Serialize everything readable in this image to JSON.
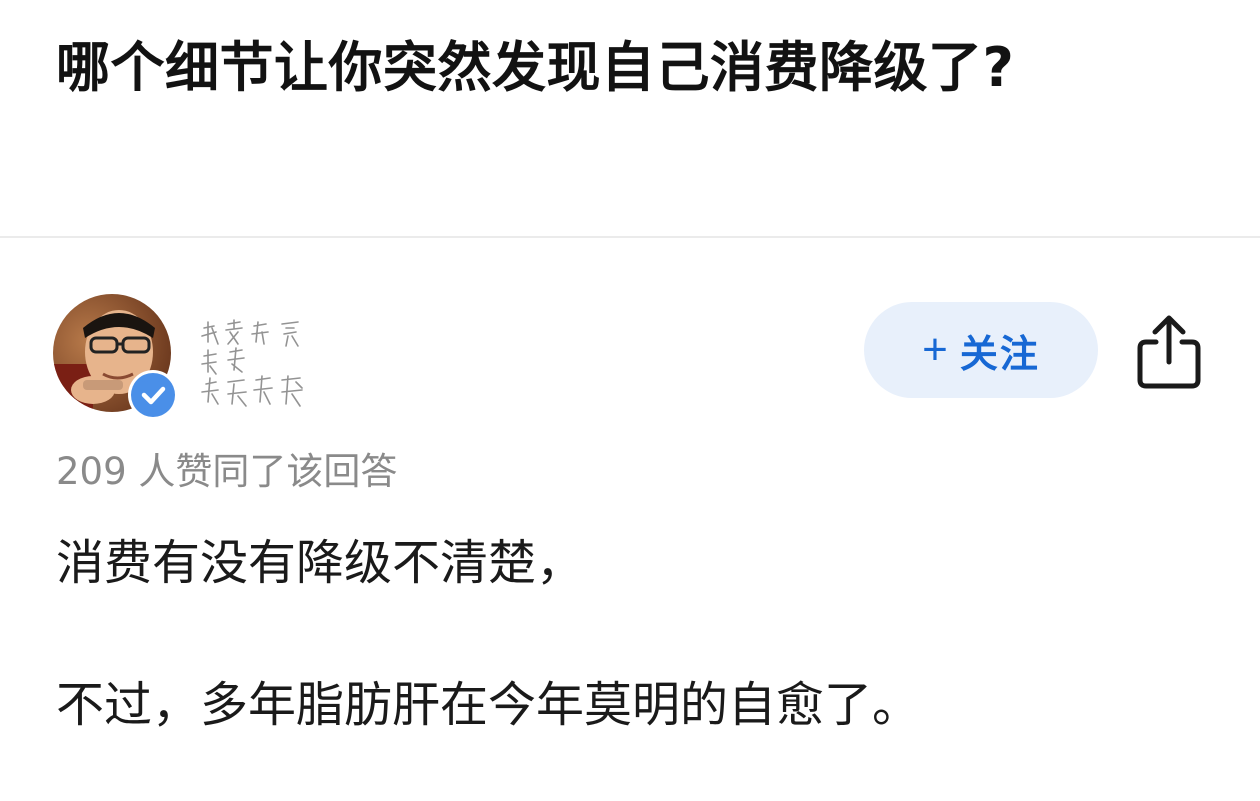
{
  "question": {
    "title": "哪个细节让你突然发现自己消费降级了?"
  },
  "author": {
    "name": "我家老婆是最好的最可爱的",
    "verified": true
  },
  "actions": {
    "follow_plus": "+",
    "follow_label": "关注"
  },
  "answer": {
    "vote_text": "209 人赞同了该回答",
    "paragraphs": [
      "消费有没有降级不清楚，",
      "不过，多年脂肪肝在今年莫明的自愈了。"
    ]
  },
  "colors": {
    "accent": "#1768d4",
    "follow_bg": "#e8f0fb",
    "verified_badge": "#4a8fe8",
    "muted_text": "#8a8a8a"
  }
}
